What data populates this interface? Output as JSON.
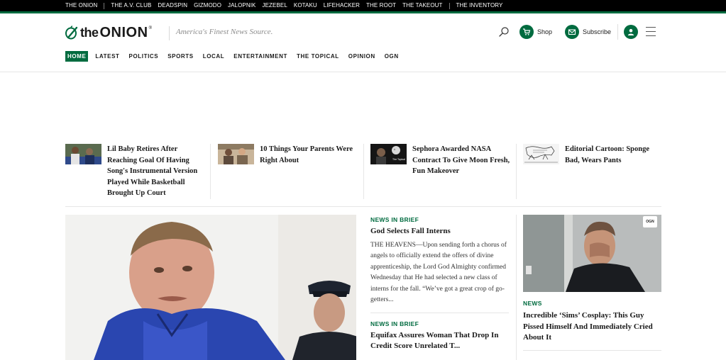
{
  "network": [
    "THE ONION",
    "THE A.V. CLUB",
    "DEADSPIN",
    "GIZMODO",
    "JALOPNIK",
    "JEZEBEL",
    "KOTAKU",
    "LIFEHACKER",
    "THE ROOT",
    "THE TAKEOUT",
    "THE INVENTORY"
  ],
  "header": {
    "logo_the": "the",
    "logo_onion": "ONION",
    "logo_reg": "®",
    "tagline": "America's Finest News Source.",
    "shop_label": "Shop",
    "subscribe_label": "Subscribe"
  },
  "nav": [
    "HOME",
    "LATEST",
    "POLITICS",
    "SPORTS",
    "LOCAL",
    "ENTERTAINMENT",
    "THE TOPICAL",
    "OPINION",
    "OGN"
  ],
  "trending": [
    {
      "title": "Lil Baby Retires After Reaching Goal Of Having Song's Instrumental Version Played While Basketball Brought Up Court"
    },
    {
      "title": "10 Things Your Parents Were Right About"
    },
    {
      "title": "Sephora Awarded NASA Contract To Give Moon Fresh, Fun Makeover",
      "thumb_text": "The Topical"
    },
    {
      "title": "Editorial Cartoon: Sponge Bad, Wears Pants"
    }
  ],
  "briefs": [
    {
      "kicker": "NEWS IN BRIEF",
      "headline": "God Selects Fall Interns",
      "body": "THE HEAVENS—Upon sending forth a chorus of angels to officially extend the offers of divine apprenticeship, the Lord God Almighty confirmed Wednesday that He had selected a new class of interns for the fall. “We’ve got a great crop of go-getters..."
    },
    {
      "kicker": "NEWS IN BRIEF",
      "headline": "Equifax Assures Woman That Drop In Credit Score Unrelated T..."
    }
  ],
  "side_story": {
    "badge": "OGN",
    "kicker": "NEWS",
    "headline": "Incredible ‘Sims’ Cosplay: This Guy Pissed Himself And Immediately Cried About It"
  },
  "colors": {
    "brand_green": "#006b3f",
    "network_bar": "#000000"
  }
}
